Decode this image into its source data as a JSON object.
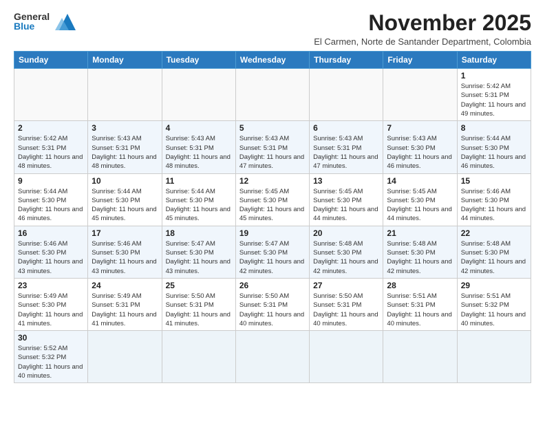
{
  "header": {
    "logo_line1": "General",
    "logo_line2": "Blue",
    "month_title": "November 2025",
    "location": "El Carmen, Norte de Santander Department, Colombia"
  },
  "days_of_week": [
    "Sunday",
    "Monday",
    "Tuesday",
    "Wednesday",
    "Thursday",
    "Friday",
    "Saturday"
  ],
  "weeks": [
    [
      {
        "day": "",
        "info": ""
      },
      {
        "day": "",
        "info": ""
      },
      {
        "day": "",
        "info": ""
      },
      {
        "day": "",
        "info": ""
      },
      {
        "day": "",
        "info": ""
      },
      {
        "day": "",
        "info": ""
      },
      {
        "day": "1",
        "info": "Sunrise: 5:42 AM\nSunset: 5:31 PM\nDaylight: 11 hours and 49 minutes."
      }
    ],
    [
      {
        "day": "2",
        "info": "Sunrise: 5:42 AM\nSunset: 5:31 PM\nDaylight: 11 hours and 48 minutes."
      },
      {
        "day": "3",
        "info": "Sunrise: 5:43 AM\nSunset: 5:31 PM\nDaylight: 11 hours and 48 minutes."
      },
      {
        "day": "4",
        "info": "Sunrise: 5:43 AM\nSunset: 5:31 PM\nDaylight: 11 hours and 48 minutes."
      },
      {
        "day": "5",
        "info": "Sunrise: 5:43 AM\nSunset: 5:31 PM\nDaylight: 11 hours and 47 minutes."
      },
      {
        "day": "6",
        "info": "Sunrise: 5:43 AM\nSunset: 5:31 PM\nDaylight: 11 hours and 47 minutes."
      },
      {
        "day": "7",
        "info": "Sunrise: 5:43 AM\nSunset: 5:30 PM\nDaylight: 11 hours and 46 minutes."
      },
      {
        "day": "8",
        "info": "Sunrise: 5:44 AM\nSunset: 5:30 PM\nDaylight: 11 hours and 46 minutes."
      }
    ],
    [
      {
        "day": "9",
        "info": "Sunrise: 5:44 AM\nSunset: 5:30 PM\nDaylight: 11 hours and 46 minutes."
      },
      {
        "day": "10",
        "info": "Sunrise: 5:44 AM\nSunset: 5:30 PM\nDaylight: 11 hours and 45 minutes."
      },
      {
        "day": "11",
        "info": "Sunrise: 5:44 AM\nSunset: 5:30 PM\nDaylight: 11 hours and 45 minutes."
      },
      {
        "day": "12",
        "info": "Sunrise: 5:45 AM\nSunset: 5:30 PM\nDaylight: 11 hours and 45 minutes."
      },
      {
        "day": "13",
        "info": "Sunrise: 5:45 AM\nSunset: 5:30 PM\nDaylight: 11 hours and 44 minutes."
      },
      {
        "day": "14",
        "info": "Sunrise: 5:45 AM\nSunset: 5:30 PM\nDaylight: 11 hours and 44 minutes."
      },
      {
        "day": "15",
        "info": "Sunrise: 5:46 AM\nSunset: 5:30 PM\nDaylight: 11 hours and 44 minutes."
      }
    ],
    [
      {
        "day": "16",
        "info": "Sunrise: 5:46 AM\nSunset: 5:30 PM\nDaylight: 11 hours and 43 minutes."
      },
      {
        "day": "17",
        "info": "Sunrise: 5:46 AM\nSunset: 5:30 PM\nDaylight: 11 hours and 43 minutes."
      },
      {
        "day": "18",
        "info": "Sunrise: 5:47 AM\nSunset: 5:30 PM\nDaylight: 11 hours and 43 minutes."
      },
      {
        "day": "19",
        "info": "Sunrise: 5:47 AM\nSunset: 5:30 PM\nDaylight: 11 hours and 42 minutes."
      },
      {
        "day": "20",
        "info": "Sunrise: 5:48 AM\nSunset: 5:30 PM\nDaylight: 11 hours and 42 minutes."
      },
      {
        "day": "21",
        "info": "Sunrise: 5:48 AM\nSunset: 5:30 PM\nDaylight: 11 hours and 42 minutes."
      },
      {
        "day": "22",
        "info": "Sunrise: 5:48 AM\nSunset: 5:30 PM\nDaylight: 11 hours and 42 minutes."
      }
    ],
    [
      {
        "day": "23",
        "info": "Sunrise: 5:49 AM\nSunset: 5:30 PM\nDaylight: 11 hours and 41 minutes."
      },
      {
        "day": "24",
        "info": "Sunrise: 5:49 AM\nSunset: 5:31 PM\nDaylight: 11 hours and 41 minutes."
      },
      {
        "day": "25",
        "info": "Sunrise: 5:50 AM\nSunset: 5:31 PM\nDaylight: 11 hours and 41 minutes."
      },
      {
        "day": "26",
        "info": "Sunrise: 5:50 AM\nSunset: 5:31 PM\nDaylight: 11 hours and 40 minutes."
      },
      {
        "day": "27",
        "info": "Sunrise: 5:50 AM\nSunset: 5:31 PM\nDaylight: 11 hours and 40 minutes."
      },
      {
        "day": "28",
        "info": "Sunrise: 5:51 AM\nSunset: 5:31 PM\nDaylight: 11 hours and 40 minutes."
      },
      {
        "day": "29",
        "info": "Sunrise: 5:51 AM\nSunset: 5:32 PM\nDaylight: 11 hours and 40 minutes."
      }
    ],
    [
      {
        "day": "30",
        "info": "Sunrise: 5:52 AM\nSunset: 5:32 PM\nDaylight: 11 hours and 40 minutes."
      },
      {
        "day": "",
        "info": ""
      },
      {
        "day": "",
        "info": ""
      },
      {
        "day": "",
        "info": ""
      },
      {
        "day": "",
        "info": ""
      },
      {
        "day": "",
        "info": ""
      },
      {
        "day": "",
        "info": ""
      }
    ]
  ]
}
